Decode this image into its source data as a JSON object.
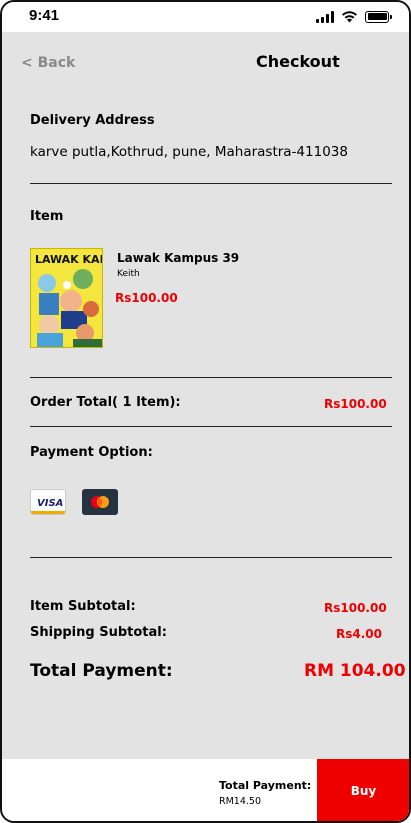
{
  "status": {
    "time": "9:41"
  },
  "nav": {
    "back_label": "< Back",
    "title": "Checkout"
  },
  "delivery": {
    "heading": "Delivery  Address",
    "address": "karve putla,Kothrud, pune, Maharastra-411038"
  },
  "item_section": {
    "heading": "Item",
    "item": {
      "title": "Lawak Kampus 39",
      "author": "Keith",
      "price": "Rs100.00",
      "cover_text": "LAWAK KAMPUS"
    }
  },
  "order": {
    "label": "Order Total( 1 Item):",
    "value": "Rs100.00"
  },
  "payment": {
    "heading": "Payment Option:",
    "visa_label": "VISA",
    "options": [
      "visa",
      "mastercard"
    ]
  },
  "summary": {
    "item_subtotal_label": "Item Subtotal:",
    "item_subtotal_value": "Rs100.00",
    "shipping_label": "Shipping Subtotal:",
    "shipping_value": "Rs4.00",
    "total_label": "Total Payment:",
    "total_value": "RM 104.00"
  },
  "footer": {
    "total_label": "Total Payment:",
    "total_value": "RM14.50",
    "buy_label": "Buy"
  },
  "colors": {
    "accent": "#ee0000",
    "background": "#e3e3e3"
  }
}
